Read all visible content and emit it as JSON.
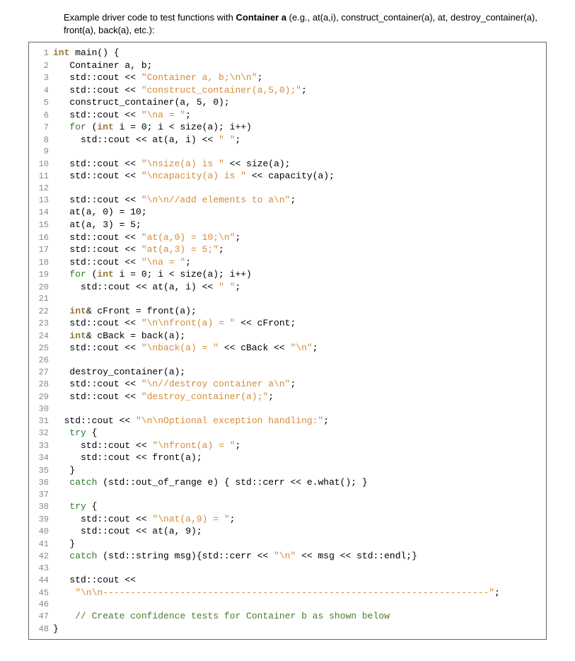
{
  "intro_pre": "Example driver code to test functions with ",
  "intro_bold": "Container a",
  "intro_post": " (e.g., at(a,i), construct_container(a), at, destroy_container(a), front(a), back(a), etc.):",
  "lines": [
    [
      {
        "cls": "bi",
        "t": "int"
      },
      {
        "cls": "id",
        "t": " main() {"
      }
    ],
    [
      {
        "cls": "id",
        "t": "   Container a, b;"
      }
    ],
    [
      {
        "cls": "id",
        "t": "   std::cout << "
      },
      {
        "cls": "str",
        "t": "\"Container a, b;\\n\\n\""
      },
      {
        "cls": "id",
        "t": ";"
      }
    ],
    [
      {
        "cls": "id",
        "t": "   std::cout << "
      },
      {
        "cls": "str",
        "t": "\"construct_container(a,5,0);\""
      },
      {
        "cls": "id",
        "t": ";"
      }
    ],
    [
      {
        "cls": "id",
        "t": "   construct_container(a, 5, 0);"
      }
    ],
    [
      {
        "cls": "id",
        "t": "   std::cout << "
      },
      {
        "cls": "str",
        "t": "\"\\na = \""
      },
      {
        "cls": "id",
        "t": ";"
      }
    ],
    [
      {
        "cls": "id",
        "t": "   "
      },
      {
        "cls": "kw",
        "t": "for"
      },
      {
        "cls": "id",
        "t": " ("
      },
      {
        "cls": "bi",
        "t": "int"
      },
      {
        "cls": "id",
        "t": " i = 0; i < size(a); i++)"
      }
    ],
    [
      {
        "cls": "id",
        "t": "     std::cout << at(a, i) << "
      },
      {
        "cls": "str",
        "t": "\" \""
      },
      {
        "cls": "id",
        "t": ";"
      }
    ],
    [
      {
        "cls": "id",
        "t": ""
      }
    ],
    [
      {
        "cls": "id",
        "t": "   std::cout << "
      },
      {
        "cls": "str",
        "t": "\"\\nsize(a) is \""
      },
      {
        "cls": "id",
        "t": " << size(a);"
      }
    ],
    [
      {
        "cls": "id",
        "t": "   std::cout << "
      },
      {
        "cls": "str",
        "t": "\"\\ncapacity(a) is \""
      },
      {
        "cls": "id",
        "t": " << capacity(a);"
      }
    ],
    [
      {
        "cls": "id",
        "t": ""
      }
    ],
    [
      {
        "cls": "id",
        "t": "   std::cout << "
      },
      {
        "cls": "str",
        "t": "\"\\n\\n//add elements to a\\n\""
      },
      {
        "cls": "id",
        "t": ";"
      }
    ],
    [
      {
        "cls": "id",
        "t": "   at(a, 0) = 10;"
      }
    ],
    [
      {
        "cls": "id",
        "t": "   at(a, 3) = 5;"
      }
    ],
    [
      {
        "cls": "id",
        "t": "   std::cout << "
      },
      {
        "cls": "str",
        "t": "\"at(a,0) = 10;\\n\""
      },
      {
        "cls": "id",
        "t": ";"
      }
    ],
    [
      {
        "cls": "id",
        "t": "   std::cout << "
      },
      {
        "cls": "str",
        "t": "\"at(a,3) = 5;\""
      },
      {
        "cls": "id",
        "t": ";"
      }
    ],
    [
      {
        "cls": "id",
        "t": "   std::cout << "
      },
      {
        "cls": "str",
        "t": "\"\\na = \""
      },
      {
        "cls": "id",
        "t": ";"
      }
    ],
    [
      {
        "cls": "id",
        "t": "   "
      },
      {
        "cls": "kw",
        "t": "for"
      },
      {
        "cls": "id",
        "t": " ("
      },
      {
        "cls": "bi",
        "t": "int"
      },
      {
        "cls": "id",
        "t": " i = 0; i < size(a); i++)"
      }
    ],
    [
      {
        "cls": "id",
        "t": "     std::cout << at(a, i) << "
      },
      {
        "cls": "str",
        "t": "\" \""
      },
      {
        "cls": "id",
        "t": ";"
      }
    ],
    [
      {
        "cls": "id",
        "t": ""
      }
    ],
    [
      {
        "cls": "id",
        "t": "   "
      },
      {
        "cls": "bi",
        "t": "int"
      },
      {
        "cls": "id",
        "t": "& cFront = front(a);"
      }
    ],
    [
      {
        "cls": "id",
        "t": "   std::cout << "
      },
      {
        "cls": "str",
        "t": "\"\\n\\nfront(a) = \""
      },
      {
        "cls": "id",
        "t": " << cFront;"
      }
    ],
    [
      {
        "cls": "id",
        "t": "   "
      },
      {
        "cls": "bi",
        "t": "int"
      },
      {
        "cls": "id",
        "t": "& cBack = back(a);"
      }
    ],
    [
      {
        "cls": "id",
        "t": "   std::cout << "
      },
      {
        "cls": "str",
        "t": "\"\\nback(a) = \""
      },
      {
        "cls": "id",
        "t": " << cBack << "
      },
      {
        "cls": "str",
        "t": "\"\\n\""
      },
      {
        "cls": "id",
        "t": ";"
      }
    ],
    [
      {
        "cls": "id",
        "t": ""
      }
    ],
    [
      {
        "cls": "id",
        "t": "   destroy_container(a);"
      }
    ],
    [
      {
        "cls": "id",
        "t": "   std::cout << "
      },
      {
        "cls": "str",
        "t": "\"\\n//destroy container a\\n\""
      },
      {
        "cls": "id",
        "t": ";"
      }
    ],
    [
      {
        "cls": "id",
        "t": "   std::cout << "
      },
      {
        "cls": "str",
        "t": "\"destroy_container(a);\""
      },
      {
        "cls": "id",
        "t": ";"
      }
    ],
    [
      {
        "cls": "id",
        "t": ""
      }
    ],
    [
      {
        "cls": "id",
        "t": "  std::cout << "
      },
      {
        "cls": "str",
        "t": "\"\\n\\nOptional exception handling:\""
      },
      {
        "cls": "id",
        "t": ";"
      }
    ],
    [
      {
        "cls": "id",
        "t": "   "
      },
      {
        "cls": "kw",
        "t": "try"
      },
      {
        "cls": "id",
        "t": " {"
      }
    ],
    [
      {
        "cls": "id",
        "t": "     std::cout << "
      },
      {
        "cls": "str",
        "t": "\"\\nfront(a) = \""
      },
      {
        "cls": "id",
        "t": ";"
      }
    ],
    [
      {
        "cls": "id",
        "t": "     std::cout << front(a);"
      }
    ],
    [
      {
        "cls": "id",
        "t": "   }"
      }
    ],
    [
      {
        "cls": "id",
        "t": "   "
      },
      {
        "cls": "kw",
        "t": "catch"
      },
      {
        "cls": "id",
        "t": " (std::out_of_range e) { std::cerr << e.what(); }"
      }
    ],
    [
      {
        "cls": "id",
        "t": ""
      }
    ],
    [
      {
        "cls": "id",
        "t": "   "
      },
      {
        "cls": "kw",
        "t": "try"
      },
      {
        "cls": "id",
        "t": " {"
      }
    ],
    [
      {
        "cls": "id",
        "t": "     std::cout << "
      },
      {
        "cls": "str",
        "t": "\"\\nat(a,9) = \""
      },
      {
        "cls": "id",
        "t": ";"
      }
    ],
    [
      {
        "cls": "id",
        "t": "     std::cout << at(a, 9);"
      }
    ],
    [
      {
        "cls": "id",
        "t": "   }"
      }
    ],
    [
      {
        "cls": "id",
        "t": "   "
      },
      {
        "cls": "kw",
        "t": "catch"
      },
      {
        "cls": "id",
        "t": " (std::string msg){std::cerr << "
      },
      {
        "cls": "str",
        "t": "\"\\n\""
      },
      {
        "cls": "id",
        "t": " << msg << std::endl;}"
      }
    ],
    [
      {
        "cls": "id",
        "t": ""
      }
    ],
    [
      {
        "cls": "id",
        "t": "   std::cout <<"
      }
    ],
    [
      {
        "cls": "id",
        "t": "    "
      },
      {
        "cls": "str",
        "t": "\"\\n\\n----------------------------------------------------------------------\""
      },
      {
        "cls": "id",
        "t": ";"
      }
    ],
    [
      {
        "cls": "id",
        "t": ""
      }
    ],
    [
      {
        "cls": "id",
        "t": "    "
      },
      {
        "cls": "cm",
        "t": "// Create confidence tests for Container b as shown below"
      }
    ],
    [
      {
        "cls": "id",
        "t": "}"
      }
    ]
  ]
}
